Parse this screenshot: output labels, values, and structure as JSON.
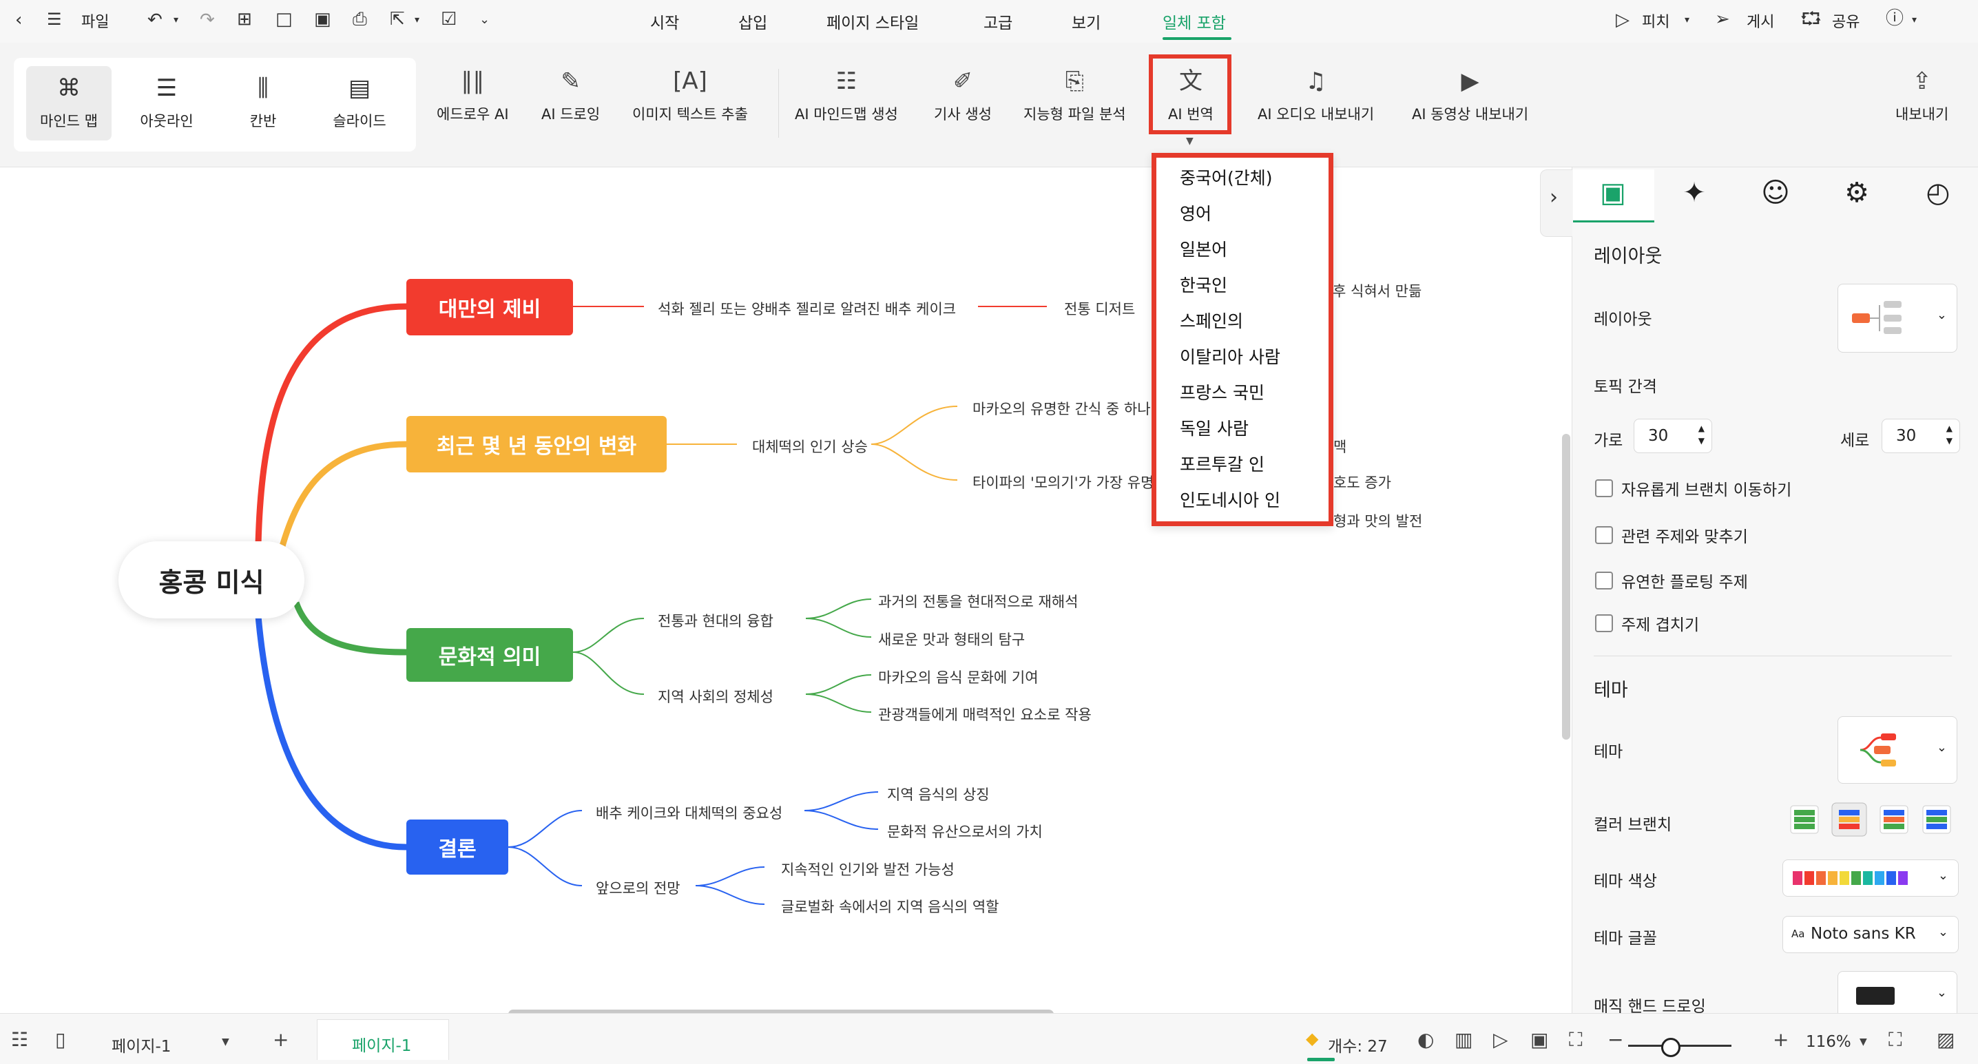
{
  "menubar": {
    "file_label": "파일",
    "tabs": [
      "시작",
      "삽입",
      "페이지 스타일",
      "고급",
      "보기",
      "일체 포함"
    ],
    "active_tab": "일체 포함",
    "pitch_label": "피치",
    "publish_label": "게시",
    "share_label": "공유"
  },
  "ribbon": {
    "views": [
      "마인드 맵",
      "아웃라인",
      "칸반",
      "슬라이드"
    ],
    "active_view": "마인드 맵",
    "tools": [
      "에드로우 AI",
      "AI 드로잉",
      "이미지 텍스트 추출",
      "AI 마인드맵 생성",
      "기사 생성",
      "지능형 파일 분석",
      "AI 번역",
      "AI 오디오 내보내기",
      "AI 동영상 내보내기"
    ],
    "export_label": "내보내기"
  },
  "translate_menu": {
    "languages": [
      "중국어(간체)",
      "영어",
      "일본어",
      "한국인",
      "스페인의",
      "이탈리아 사람",
      "프랑스 국민",
      "독일 사람",
      "포르투갈 인",
      "인도네시아 인"
    ]
  },
  "mindmap": {
    "central": "홍콩 미식",
    "topics": [
      {
        "label": "대만의 제비",
        "color": "#f23b2e",
        "sub1": "석화 젤리 또는 양배추 젤리로 알려진 배추 케이크",
        "sub2": "전통 디저트",
        "sub3": "후 식혀서 만듦"
      },
      {
        "label": "최근 몇 년 동안의 변화",
        "color": "#f7b33a",
        "sub": "대체떡의 인기 상승",
        "leaves": [
          "마카오의 유명한 간식 중 하나",
          "타이파의 '모의기'가 가장 유명",
          "맥",
          "호도 증가",
          "형과 맛의 발전"
        ]
      },
      {
        "label": "문화적 의미",
        "color": "#45a84a",
        "subs": [
          {
            "label": "전통과 현대의 융합",
            "leaves": [
              "과거의 전통을 현대적으로 재해석",
              "새로운 맛과 형태의 탐구"
            ]
          },
          {
            "label": "지역 사회의 정체성",
            "leaves": [
              "마카오의 음식 문화에 기여",
              "관광객들에게 매력적인 요소로 작용"
            ]
          }
        ]
      },
      {
        "label": "결론",
        "color": "#2862f0",
        "subs": [
          {
            "label": "배추 케이크와 대체떡의 중요성",
            "leaves": [
              "지역 음식의 상징",
              "문화적 유산으로서의 가치"
            ]
          },
          {
            "label": "앞으로의 전망",
            "leaves": [
              "지속적인 인기와 발전 가능성",
              "글로벌화 속에서의 지역 음식의 역할"
            ]
          }
        ]
      }
    ]
  },
  "panel": {
    "layout_section": "레이아웃",
    "layout_label": "레이아웃",
    "spacing_label": "토픽 간격",
    "horizontal_label": "가로",
    "horizontal_value": "30",
    "vertical_label": "세로",
    "vertical_value": "30",
    "checkboxes": [
      "자유롭게 브랜치 이동하기",
      "관련 주제와 맞추기",
      "유연한 플로팅 주제",
      "주제 겹치기"
    ],
    "theme_section": "테마",
    "theme_label": "테마",
    "color_branch_label": "컬러 브랜치",
    "theme_color_label": "테마 색상",
    "theme_font_label": "테마 글꼴",
    "font_value": "Noto sans KR",
    "font_prefix": "Aa",
    "hand_drawing_label": "매직 핸드 드로잉"
  },
  "statusbar": {
    "page_selector": "페이지-1",
    "active_page_tab": "페이지-1",
    "count_label": "개수: 27",
    "zoom": "116%"
  }
}
